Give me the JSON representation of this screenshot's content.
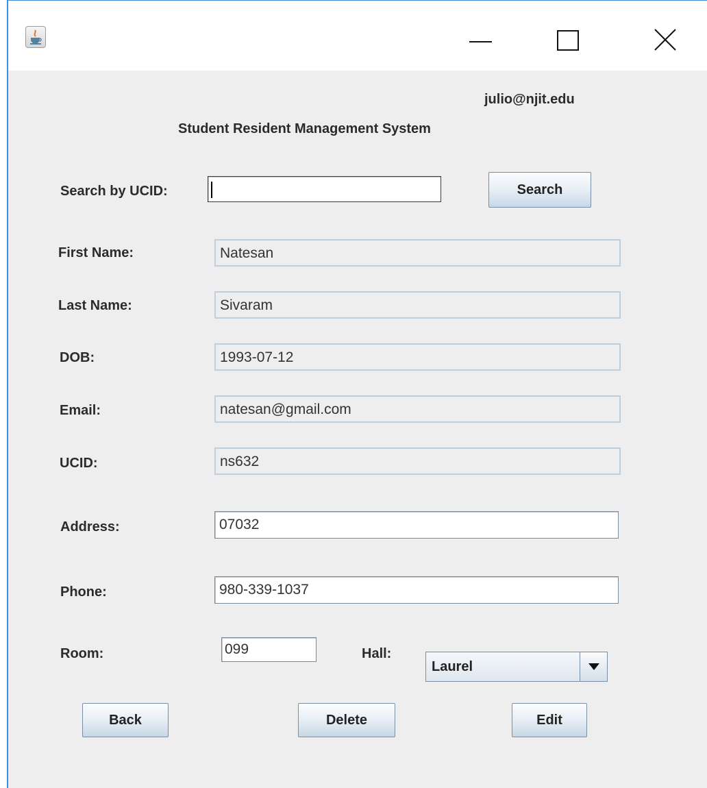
{
  "window": {
    "title": "",
    "controls": [
      "minimize",
      "maximize",
      "close"
    ]
  },
  "header": {
    "user_email": "julio@njit.edu",
    "app_title": "Student Resident Management System"
  },
  "search": {
    "label": "Search by UCID:",
    "value": "",
    "button_label": "Search"
  },
  "fields": {
    "first_name": {
      "label": "First Name:",
      "value": "Natesan"
    },
    "last_name": {
      "label": "Last Name:",
      "value": "Sivaram"
    },
    "dob": {
      "label": "DOB:",
      "value": "1993-07-12"
    },
    "email": {
      "label": "Email:",
      "value": "natesan@gmail.com"
    },
    "ucid": {
      "label": "UCID:",
      "value": "ns632"
    },
    "address": {
      "label": "Address:",
      "value": "07032"
    },
    "phone": {
      "label": "Phone:",
      "value": "980-339-1037"
    },
    "room": {
      "label": "Room:",
      "value": "099"
    },
    "hall": {
      "label": "Hall:",
      "selected": "Laurel"
    }
  },
  "actions": {
    "back_label": "Back",
    "delete_label": "Delete",
    "edit_label": "Edit"
  },
  "icons": {
    "app": "java-cup-icon",
    "minimize": "minimize-icon",
    "maximize": "maximize-icon",
    "close": "close-icon",
    "dropdown": "dropdown-arrow-icon"
  },
  "colors": {
    "window_border": "#3c8fd8",
    "background": "#eeeeee",
    "readonly_border": "#bdd0e2"
  }
}
